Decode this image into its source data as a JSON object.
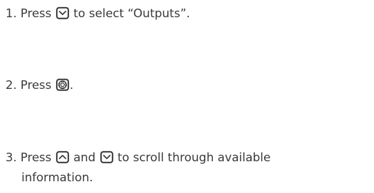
{
  "steps": [
    {
      "number": "1.",
      "before": "Press",
      "icon1": "down-arrow-button-icon",
      "after": "to select “Outputs”."
    },
    {
      "number": "2.",
      "before": "Press",
      "icon1": "center-select-button-icon",
      "after": "."
    },
    {
      "number": "3.",
      "before": "Press",
      "icon1": "up-arrow-button-icon",
      "middle": "and",
      "icon2": "down-arrow-button-icon",
      "after": "to scroll through available",
      "continuation": "information."
    }
  ]
}
